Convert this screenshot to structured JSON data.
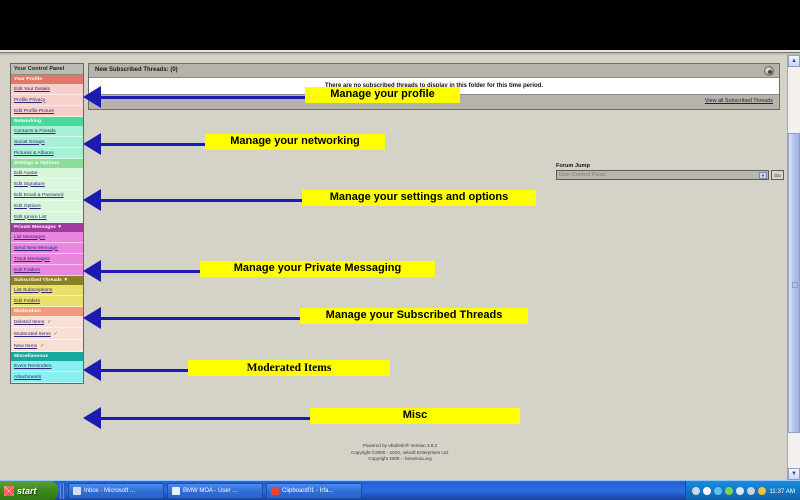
{
  "browser": {
    "scrollbar": {
      "up_glyph": "▲",
      "down_glyph": "▼"
    }
  },
  "sidebar": {
    "title": "Your Control Panel",
    "sections": [
      {
        "name": "Your Profile",
        "header_color": "#e5766c",
        "item_color": "#f7cfcb",
        "items": [
          {
            "label": "Edit Your Details"
          },
          {
            "label": "Profile Privacy"
          },
          {
            "label": "Edit Profile Picture"
          }
        ]
      },
      {
        "name": "Networking",
        "header_color": "#49d99a",
        "item_color": "#a8f0d6",
        "items": [
          {
            "label": "Contacts & Friends"
          },
          {
            "label": "Social Groups"
          },
          {
            "label": "Pictures & Albums"
          }
        ]
      },
      {
        "name": "Settings & Options",
        "header_color": "#8ddc9a",
        "item_color": "#d8f7da",
        "items": [
          {
            "label": "Edit Avatar"
          },
          {
            "label": "Edit Signature"
          },
          {
            "label": "Edit Email & Password"
          },
          {
            "label": "Edit Options"
          },
          {
            "label": "Edit Ignore List"
          }
        ]
      },
      {
        "name": "Private Messages ▼",
        "header_color": "#a33b9e",
        "item_color": "#eb86e0",
        "items": [
          {
            "label": "List Messages"
          },
          {
            "label": "Send New Message"
          },
          {
            "label": "Track Messages"
          },
          {
            "label": "Edit Folders"
          }
        ]
      },
      {
        "name": "Subscribed Threads ▼",
        "header_color": "#8a8222",
        "item_color": "#e8e06a",
        "items": [
          {
            "label": "List Subscriptions"
          },
          {
            "label": "Edit Folders"
          }
        ]
      },
      {
        "name": "Moderation",
        "header_color": "#f09a7e",
        "item_color": "#fadfd7",
        "items": [
          {
            "label": "Deleted Items",
            "check": "✓"
          },
          {
            "label": "Moderated Items",
            "check": "✓"
          },
          {
            "label": "New Items",
            "check": "✓"
          }
        ]
      },
      {
        "name": "Miscellaneous",
        "header_color": "#16a89b",
        "item_color": "#8aeff0",
        "items": [
          {
            "label": "Event Reminders"
          },
          {
            "label": "Attachments"
          }
        ]
      }
    ]
  },
  "content": {
    "header_title": "New Subscribed Threads: (0)",
    "body_message": "There are no subscribed threads to display in this folder for this time period.",
    "footer_link": "View all Subscribed Threads",
    "collapse_icon_name": "collapse-toggle-icon"
  },
  "forum_jump": {
    "label": "Forum Jump",
    "selected": "User Control Panel",
    "arrow_glyph": "▼",
    "go_label": "Go"
  },
  "callouts": [
    {
      "text": "Manage your profile"
    },
    {
      "text": "Manage your networking"
    },
    {
      "text": "Manage your settings and options"
    },
    {
      "text": "Manage your Private Messaging"
    },
    {
      "text": "Manage your Subscribed Threads"
    },
    {
      "text": "Moderated Items"
    },
    {
      "text": "Misc"
    }
  ],
  "footer": {
    "line1": "Powered by vBulletin® Version 3.8.2",
    "line2": "Copyright ©2000 - 2010, Jelsoft Enterprises Ltd.",
    "line3": "Copyright 2009 -- bmwmoa.org"
  },
  "taskbar": {
    "start_label": "start",
    "tasks": [
      {
        "label": "Inbox - Microsoft ...",
        "icon_color": "#d9dde8"
      },
      {
        "label": "BMW MOA - User ...",
        "icon_color": "#e8eef8"
      },
      {
        "label": "Clipboard01 - Irfa...",
        "icon_color": "#e8443a"
      }
    ],
    "tray": {
      "time": "11:37 AM",
      "icons": [
        {
          "name": "network-icon",
          "color": "#cfd8e8"
        },
        {
          "name": "question-icon",
          "color": "#ffffff"
        },
        {
          "name": "shield-icon",
          "color": "#5fc0f0"
        },
        {
          "name": "messenger-icon",
          "color": "#7fd34f"
        },
        {
          "name": "volume-icon",
          "color": "#dde6f2"
        },
        {
          "name": "usb-icon",
          "color": "#c8d4e4"
        },
        {
          "name": "update-icon",
          "color": "#f0c040"
        }
      ]
    }
  },
  "colors": {
    "highlight": "#ffff00",
    "arrow": "#1b1bb0",
    "page_bg": "#d5d3c8"
  }
}
